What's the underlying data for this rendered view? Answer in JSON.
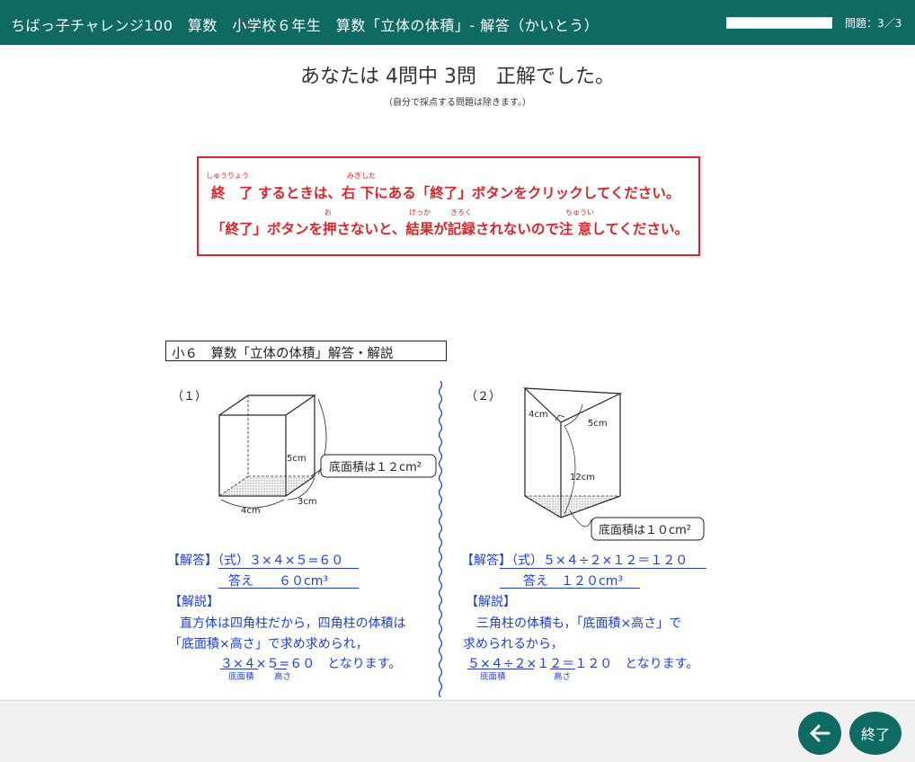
{
  "header": {
    "title": "ちばっ子チャレンジ100　算数　小学校６年生　算数「立体の体積」- 解答（かいとう）",
    "progress_fraction": 1.0,
    "question_counter": "問題：3／3"
  },
  "result": {
    "message": "あなたは 4問中 3問　正解でした。",
    "note": "（自分で採点する問題は除きます。）"
  },
  "notice": {
    "line1": "終　了 するときは、右 下にある「終了」ボタンをクリックしてください。",
    "line2": "「終了」ボタンを押さないと、結果が記録されないので注 意してください。",
    "ruby": {
      "shuuryou": "しゅうりょう",
      "migishita": "みぎした",
      "o": "お",
      "kekka": "けっか",
      "kiroku": "きろく",
      "chuui": "ちゅうい"
    }
  },
  "worksheet": {
    "title": "小６　算数「立体の体積」解答・解説",
    "q1": {
      "label": "（１）",
      "dim_height": "5cm",
      "dim_depth": "3cm",
      "dim_width": "4cm",
      "callout": "底面積は１２cm²",
      "answer_formula": "【解答】（式）３×４×５=６０",
      "answer": "答え　　６０cm³",
      "explain_heading": "【解説】",
      "explain_1": "直方体は四角柱だから，四角柱の体積は",
      "explain_2": "「底面積×高さ」で求め求められ，",
      "calc": "３×４×５=６０　となります。",
      "under_base": "底面積",
      "under_height": "高さ"
    },
    "q2": {
      "label": "（２）",
      "dim_a": "4cm",
      "dim_b": "5cm",
      "dim_height": "12cm",
      "callout": "底面積は１０cm²",
      "answer_formula": "【解答】（式）５×４÷２×１２＝１２０",
      "answer": "答え　１２０cm³",
      "explain_heading": "【解説】",
      "explain_1": "三角柱の体積も，「底面積×高さ」で",
      "explain_2": "求められるから，",
      "calc": "５×４÷２×１２＝１２０　となります。",
      "under_base": "底面積",
      "under_height": "高さ"
    }
  },
  "footer": {
    "back_icon": "arrow-left-icon",
    "end_label": "終了"
  },
  "colors": {
    "header_bg": "#0e6a62",
    "notice_red": "#d8262b",
    "answer_blue": "#1e3fd1"
  }
}
